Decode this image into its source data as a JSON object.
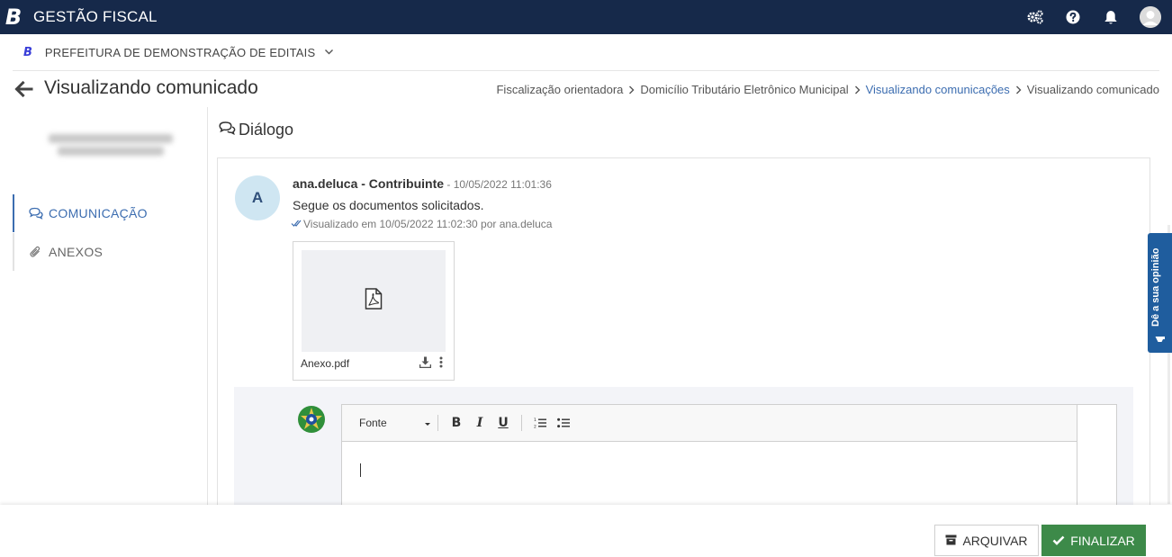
{
  "topbar": {
    "logo": "B",
    "app_title": "GESTÃO FISCAL",
    "icons": [
      "settings-cogs-icon",
      "help-icon",
      "bell-icon",
      "user-avatar"
    ]
  },
  "org": {
    "logo": "B",
    "name": "PREFEITURA DE DEMONSTRAÇÃO DE EDITAIS"
  },
  "header": {
    "title": "Visualizando comunicado",
    "breadcrumb": [
      "Fiscalização orientadora",
      "Domicílio Tributário Eletrônico Municipal",
      "Visualizando comunicações",
      "Visualizando comunicado"
    ]
  },
  "sidebar": {
    "items": [
      {
        "label": "COMUNICAÇÃO",
        "icon": "comments-icon",
        "active": true
      },
      {
        "label": "ANEXOS",
        "icon": "paperclip-icon",
        "active": false
      }
    ]
  },
  "dialog": {
    "title": "Diálogo",
    "message": {
      "avatar_initial": "A",
      "author": "ana.deluca - Contribuinte",
      "separator": " - ",
      "date": "10/05/2022 11:01:36",
      "text": "Segue os documentos solicitados.",
      "seen": "Visualizado em 10/05/2022 11:02:30 por ana.deluca",
      "attachment": {
        "name": "Anexo.pdf",
        "type_icon": "pdf-file-icon"
      }
    },
    "editor": {
      "font_label": "Fonte",
      "tools": [
        "bold",
        "italic",
        "underline",
        "ordered-list",
        "unordered-list"
      ],
      "tool_labels": {
        "bold": "B",
        "italic": "I",
        "underline": "U"
      }
    }
  },
  "footer": {
    "archive_label": "ARQUIVAR",
    "finish_label": "FINALIZAR"
  },
  "feedback_tab": {
    "label": "Dê a sua opinião"
  },
  "colors": {
    "topbar": "#16294a",
    "accent": "#3c6db0",
    "finish": "#3d8a49",
    "feedback": "#1f5d9e"
  }
}
